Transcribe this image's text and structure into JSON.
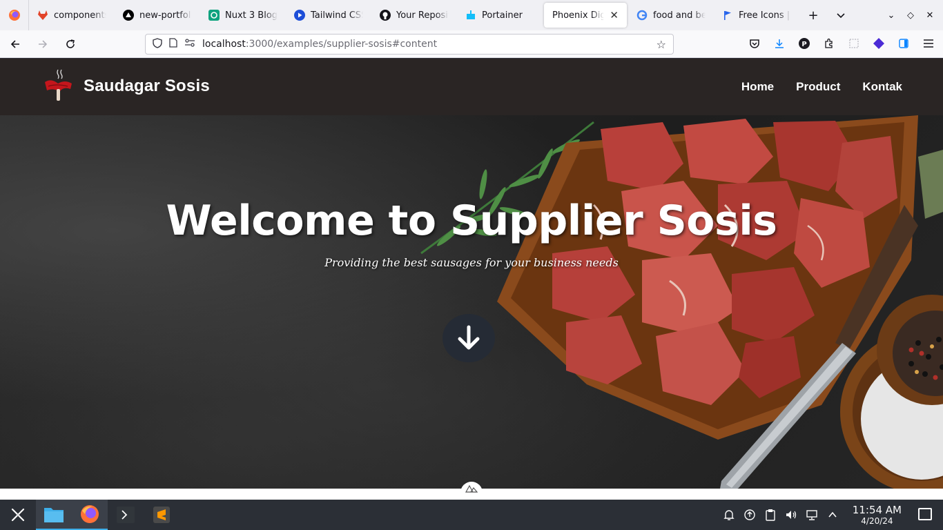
{
  "browser": {
    "tabs": [
      {
        "label": "components/",
        "favicon": "gitlab-icon",
        "color": "#e24329"
      },
      {
        "label": "new-portfolio",
        "favicon": "vercel-icon",
        "color": "#000000"
      },
      {
        "label": "Nuxt 3 Blog",
        "favicon": "openai-icon",
        "color": "#10a37f"
      },
      {
        "label": "Tailwind CSS",
        "favicon": "play-icon",
        "color": "#1d4ed8"
      },
      {
        "label": "Your Reposit",
        "favicon": "github-icon",
        "color": "#15141a"
      },
      {
        "label": "Portainer",
        "favicon": "portainer-icon",
        "color": "#13bef9"
      },
      {
        "label": "Phoenix Digit",
        "favicon": "",
        "color": "#ffffff",
        "active": true
      },
      {
        "label": "food and bev",
        "favicon": "google-icon",
        "color": "#4285f4"
      },
      {
        "label": "Free Icons |",
        "favicon": "flag-icon",
        "color": "#2563eb"
      }
    ],
    "new_tab": "+",
    "tab_list": "⌄",
    "url": {
      "host": "localhost",
      "path": ":3000/examples/supplier-sosis#content"
    }
  },
  "site": {
    "brand_name": "Saudagar Sosis",
    "nav": [
      "Home",
      "Product",
      "Kontak"
    ],
    "hero": {
      "title": "Welcome to Supplier Sosis",
      "subtitle": "Providing the best sausages for your business needs"
    }
  },
  "taskbar": {
    "time": "11:54 AM",
    "date": "4/20/24"
  },
  "colors": {
    "header_bg": "#2a2524",
    "scroll_button_bg": "#252b35",
    "taskbar_bg": "#2b2f36"
  }
}
